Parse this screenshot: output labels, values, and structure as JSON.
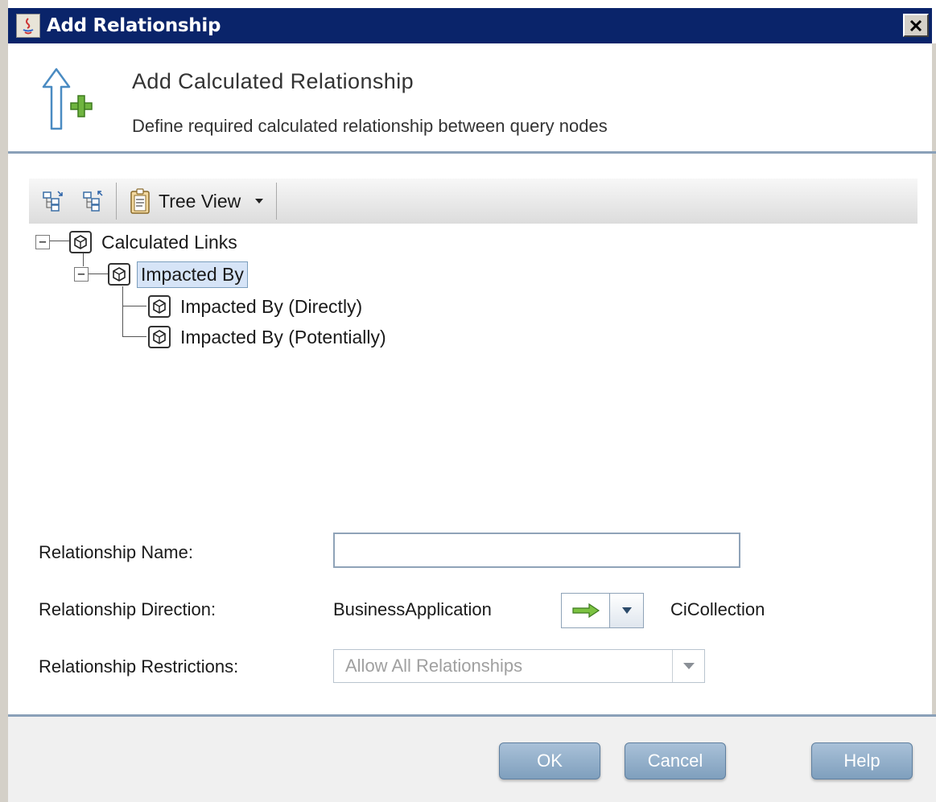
{
  "window": {
    "title": "Add Relationship"
  },
  "header": {
    "title": "Add Calculated Relationship",
    "subtitle": "Define required calculated relationship between query nodes"
  },
  "toolbar": {
    "view_label": "Tree View"
  },
  "tree": {
    "root": {
      "label": "Calculated Links",
      "expander": "−"
    },
    "child": {
      "label": "Impacted By",
      "expander": "−"
    },
    "leaves": [
      {
        "label": "Impacted By (Directly)"
      },
      {
        "label": "Impacted By (Potentially)"
      }
    ]
  },
  "form": {
    "name_label": "Relationship Name:",
    "name_value": "",
    "direction_label": "Relationship Direction:",
    "direction_source": "BusinessApplication",
    "direction_target": "CiCollection",
    "restrictions_label": "Relationship Restrictions:",
    "restrictions_value": "Allow All Relationships"
  },
  "buttons": {
    "ok": "OK",
    "cancel": "Cancel",
    "help": "Help"
  },
  "colors": {
    "titlebar": "#0a246a",
    "button": "#8fabc8",
    "separator": "#8aa0b8",
    "selection": "#d6e4f7",
    "arrow_green": "#5aa02c"
  }
}
